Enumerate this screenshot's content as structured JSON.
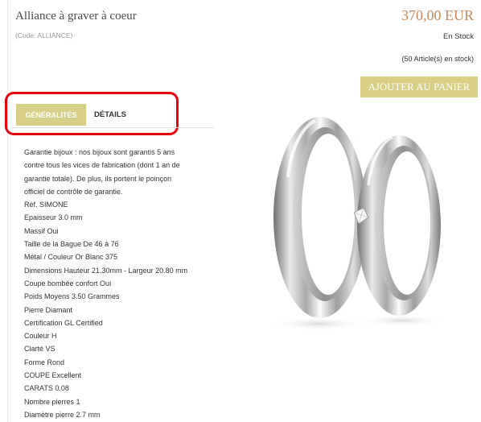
{
  "product": {
    "title": "Alliance à graver à coeur",
    "code": "(Code: ALLIANCE)",
    "price": "370,00 EUR",
    "stock_status": "En Stock",
    "stock_count": "(50 Article(s) en stock)",
    "add_to_cart_label": "AJOUTER AU PANIER"
  },
  "tabs": [
    {
      "label": "GÉNÉRALITÉS",
      "active": true
    },
    {
      "label": "DÉTAILS",
      "active": false
    }
  ],
  "specs": [
    "Garantie bijoux : nos bijoux sont garantis 5 ans",
    "contre tous les vices de fabrication (dont 1 an de",
    "garantie totale). De plus, ils portent le poinçon",
    "officiel de contrôle de garantie.",
    "Réf. SIMONE",
    "Epaisseur 3.0 mm",
    "Massif Oui",
    "Taille de la Bague De 46 à 76",
    "Métal / Couleur Or Blanc 375",
    "Dimensions Hauteur 21.30mm - Largeur 20.80 mm",
    "Coupe bombée confort Oui",
    "Poids Moyens 3.50 Grammes",
    "Pierre Diamant",
    "Certification GL Certified",
    "Couleur H",
    "Clarté VS",
    "Forme Rond",
    "COUPE Excellent",
    "CARATS 0.08",
    "Nombre pierres 1",
    "Diamètre pierre 2.7 mm"
  ],
  "colors": {
    "accent_gold": "#d6cf85",
    "price": "#c88a5d",
    "highlight_box": "#e8000f"
  }
}
